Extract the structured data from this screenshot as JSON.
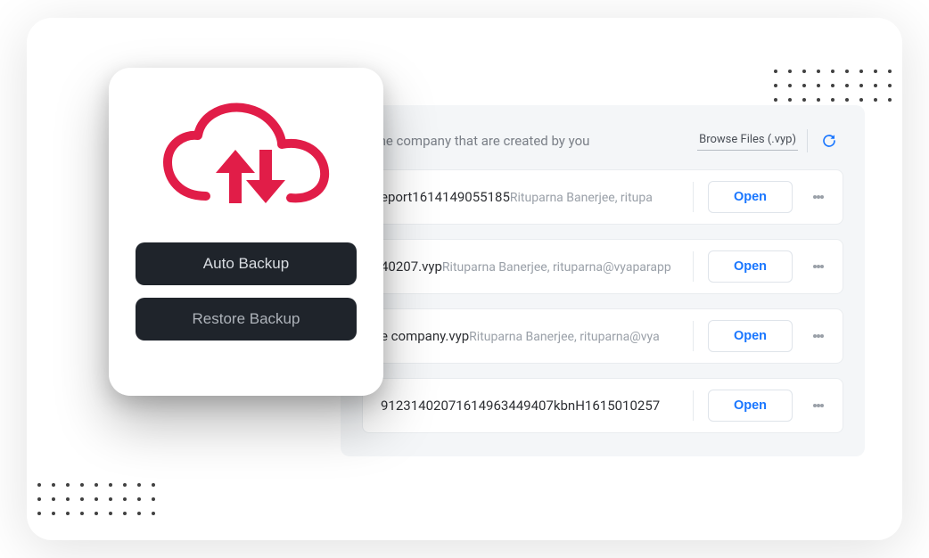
{
  "colors": {
    "accent": "#e11d48",
    "link": "#1976ff",
    "dark": "#1f242b"
  },
  "header": {
    "title_visible": "e the company that are created by you",
    "browse_label": "Browse Files (.vyp)"
  },
  "backup": {
    "auto_label": "Auto Backup",
    "restore_label": "Restore Backup"
  },
  "files": [
    {
      "name_visible": "eport1614149055185",
      "meta": "Rituparna Banerjee, ritupa",
      "open_label": "Open"
    },
    {
      "name_visible": "40207.vyp",
      "meta": "Rituparna Banerjee, rituparna@vyaparapp",
      "open_label": "Open"
    },
    {
      "name_visible": "e company.vyp",
      "meta": "Rituparna Banerjee, rituparna@vya",
      "open_label": "Open"
    },
    {
      "name_visible": "91231402071614963449407kbnH1615010257",
      "meta": "",
      "open_label": "Open"
    }
  ]
}
